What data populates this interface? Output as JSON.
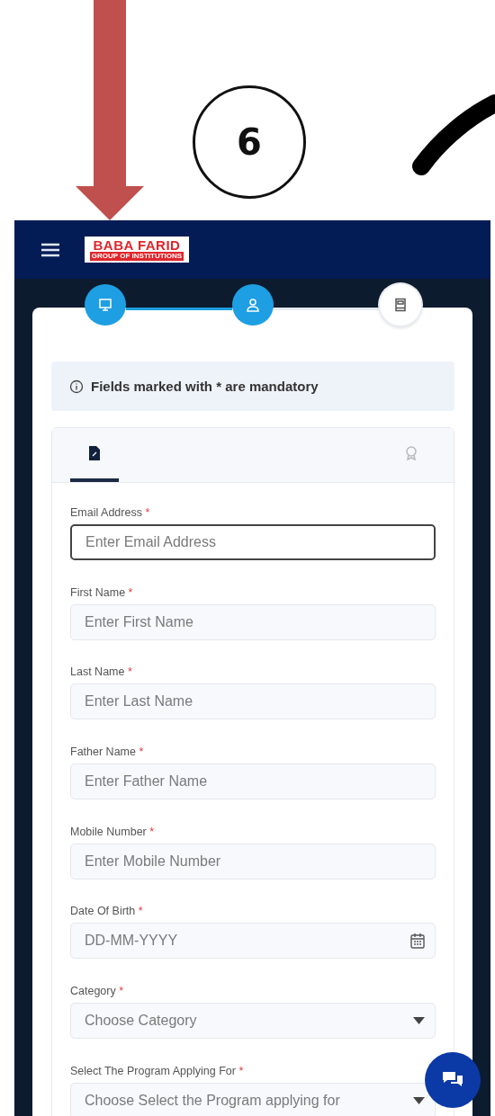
{
  "annotations": {
    "callout": "6"
  },
  "header": {
    "logo_title": "BABA FARID",
    "logo_subtitle": "GROUP OF INSTITUTIONS"
  },
  "steps": [
    {
      "done": true
    },
    {
      "done": true
    },
    {
      "done": false
    }
  ],
  "notice": "Fields marked with * are mandatory",
  "tabs": [
    {
      "selected": true
    },
    {
      "selected": false
    }
  ],
  "fields": [
    {
      "kind": "text",
      "label": "Email Address",
      "required": "*",
      "placeholder": "Enter Email Address",
      "focused": true
    },
    {
      "kind": "text",
      "label": "First Name",
      "required": "*",
      "placeholder": "Enter First Name",
      "focused": false
    },
    {
      "kind": "text",
      "label": "Last Name",
      "required": "*",
      "placeholder": "Enter Last Name",
      "focused": false
    },
    {
      "kind": "text",
      "label": "Father Name",
      "required": "*",
      "placeholder": "Enter Father Name",
      "focused": false
    },
    {
      "kind": "text",
      "label": "Mobile Number",
      "required": "*",
      "placeholder": "Enter Mobile Number",
      "focused": false
    },
    {
      "kind": "date",
      "label": "Date Of Birth",
      "required": "*",
      "placeholder": "DD-MM-YYYY",
      "focused": false
    },
    {
      "kind": "select",
      "label": "Category",
      "required": "*",
      "placeholder": "Choose Category",
      "focused": false
    },
    {
      "kind": "select",
      "label": "Select The Program Applying For",
      "required": "*",
      "placeholder": "Choose Select the Program applying for",
      "focused": false
    }
  ]
}
